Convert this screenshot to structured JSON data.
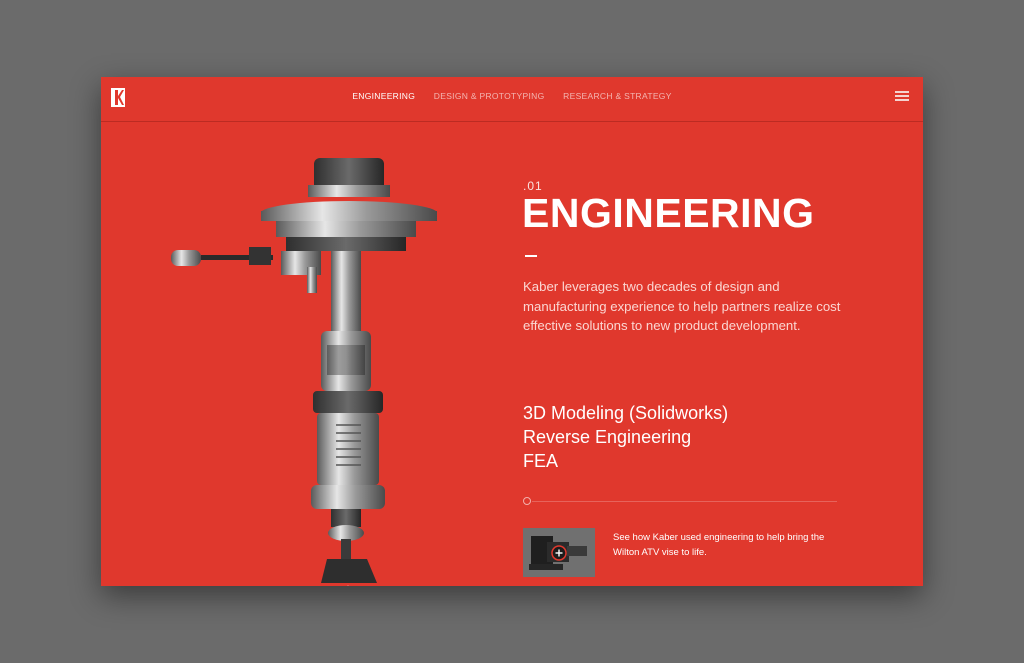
{
  "nav": {
    "items": [
      {
        "label": "ENGINEERING",
        "active": true
      },
      {
        "label": "DESIGN & PROTOTYPING",
        "active": false
      },
      {
        "label": "RESEARCH & STRATEGY",
        "active": false
      }
    ]
  },
  "hero": {
    "number": ".01",
    "title": "ENGINEERING",
    "description": "Kaber leverages two decades of design and manufacturing experience to help partners realize cost effective solutions to new product development."
  },
  "services": [
    "3D Modeling (Solidworks)",
    "Reverse Engineering",
    "FEA"
  ],
  "case_study": {
    "caption": "See how Kaber used engineering to help bring the Wilton ATV vise to life."
  },
  "colors": {
    "background": "#e0382d",
    "page": "#6b6b6b",
    "text": "#ffffff"
  },
  "icons": [
    "kaber-logo-icon",
    "hamburger-menu-icon",
    "play-icon"
  ]
}
